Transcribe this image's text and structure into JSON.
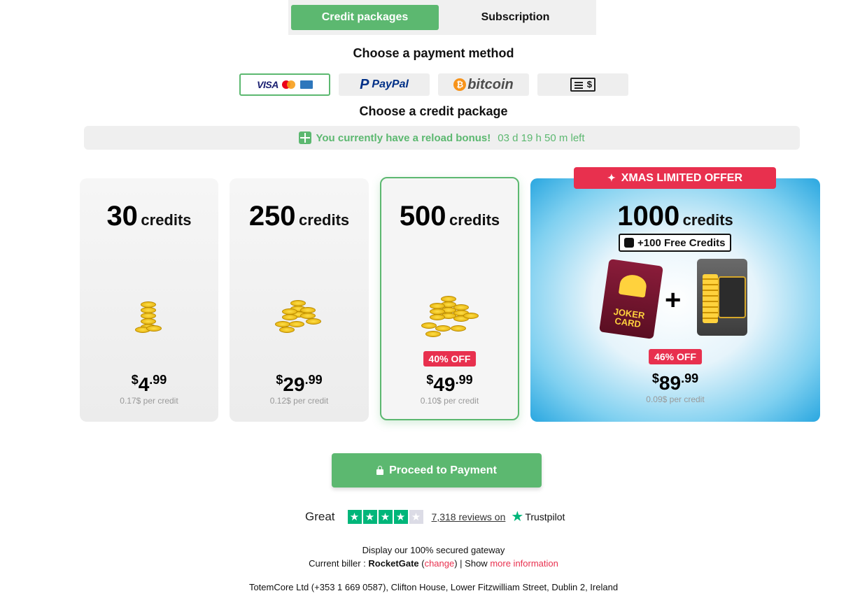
{
  "tabs": {
    "credit_packages": "Credit packages",
    "subscription": "Subscription"
  },
  "payment": {
    "title": "Choose a payment method",
    "methods": [
      "card",
      "paypal",
      "bitcoin",
      "check"
    ],
    "visa_label": "VISA",
    "paypal_label": "PayPal",
    "bitcoin_label": "bitcoin",
    "check_label": "$"
  },
  "package": {
    "title": "Choose a credit package"
  },
  "bonus": {
    "text": "You currently have a reload bonus!",
    "time_left": "03 d 19 h 50 m left"
  },
  "cards": [
    {
      "credits": "30",
      "word": "credits",
      "currency": "$",
      "price_int": "4",
      "price_dec": ".99",
      "per": "0.17$ per credit",
      "discount": ""
    },
    {
      "credits": "250",
      "word": "credits",
      "currency": "$",
      "price_int": "29",
      "price_dec": ".99",
      "per": "0.12$ per credit",
      "discount": ""
    },
    {
      "credits": "500",
      "word": "credits",
      "currency": "$",
      "price_int": "49",
      "price_dec": ".99",
      "per": "0.10$ per credit",
      "discount": "40% OFF"
    },
    {
      "credits": "1000",
      "word": "credits",
      "currency": "$",
      "price_int": "89",
      "price_dec": ".99",
      "per": "0.09$ per credit",
      "discount": "46% OFF",
      "free": "+100 Free Credits",
      "badge": "XMAS LIMITED OFFER"
    }
  ],
  "joker": {
    "line1": "JOKER",
    "line2": "CARD"
  },
  "plus_sign": "+",
  "proceed": "Proceed to Payment",
  "trust": {
    "rating": "Great",
    "rating_value": 4,
    "rating_max": 5,
    "reviews": "7,318 reviews on",
    "brand": "Trustpilot"
  },
  "footer": {
    "secured": "Display our 100% secured gateway",
    "biller_label": "Current biller : ",
    "biller": "RocketGate",
    "change": "change",
    "show": "Show",
    "more": "more information",
    "company": "TotemCore Ltd (+353 1 669 0587), Clifton House, Lower Fitzwilliam Street, Dublin 2, Ireland"
  },
  "colors": {
    "accent": "#5cb870",
    "sale": "#e8304e",
    "trustpilot": "#00b67a"
  }
}
